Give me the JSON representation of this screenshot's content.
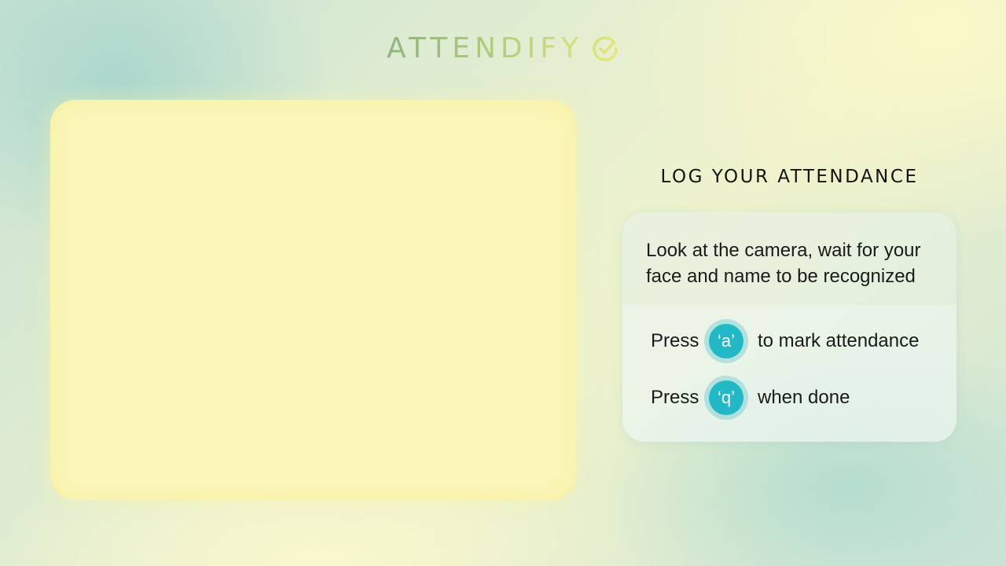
{
  "app": {
    "logo_text": "ATTENDIFY",
    "logo_icon": "check-circle-icon",
    "logo_colors": [
      "#8fb37c",
      "#d8e27a"
    ]
  },
  "camera": {
    "background_color": "#fbf7b8"
  },
  "panel": {
    "title": "LOG YOUR ATTENDANCE",
    "instruction": "Look at the camera, wait for your face and name to be recognized",
    "keys": [
      {
        "press_label": "Press",
        "key": "‘a’",
        "action": "to mark attendance"
      },
      {
        "press_label": "Press",
        "key": "‘q’",
        "action": "when done"
      }
    ],
    "key_color": "#22b8c6"
  }
}
